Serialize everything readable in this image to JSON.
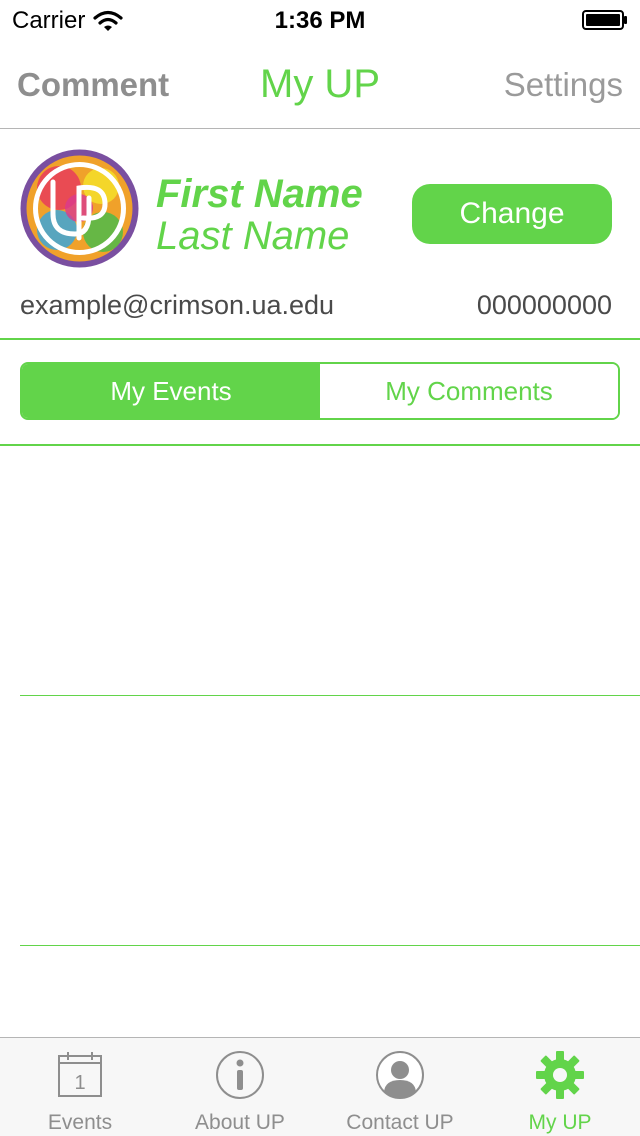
{
  "status_bar": {
    "carrier": "Carrier",
    "time": "1:36 PM",
    "icons": [
      "wifi-icon",
      "battery-icon"
    ]
  },
  "nav": {
    "left": "Comment",
    "title": "My UP",
    "right": "Settings"
  },
  "profile": {
    "logo_text": "UP",
    "first_name": "First Name",
    "last_name": "Last Name",
    "change_label": "Change",
    "email": "example@crimson.ua.edu",
    "id_number": "000000000"
  },
  "segments": {
    "my_events": "My Events",
    "my_comments": "My Comments",
    "selected": "My Events"
  },
  "list": {
    "rows": [
      "",
      ""
    ]
  },
  "tabs": [
    {
      "label": "Events",
      "icon": "calendar-icon",
      "badge": "1"
    },
    {
      "label": "About UP",
      "icon": "info-icon"
    },
    {
      "label": "Contact UP",
      "icon": "contact-icon"
    },
    {
      "label": "My UP",
      "icon": "gear-icon",
      "active": true
    }
  ],
  "colors": {
    "accent": "#62d44a",
    "inactive_tab": "#8e8e8e",
    "separator": "#b5b5b5"
  }
}
